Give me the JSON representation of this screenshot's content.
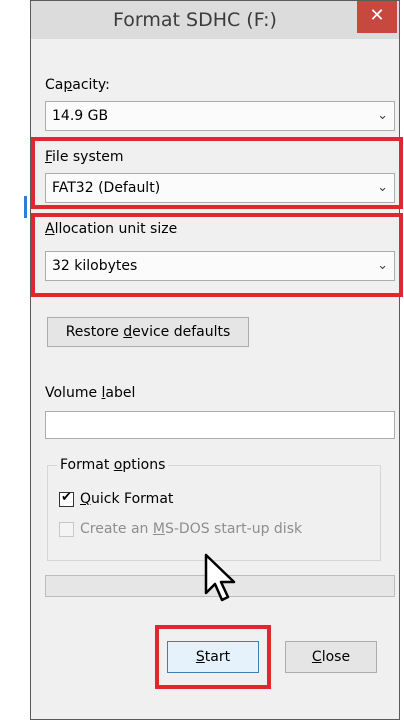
{
  "dialog": {
    "title": "Format SDHC (F:)",
    "close_glyph": "✕"
  },
  "capacity": {
    "label_pre": "Ca",
    "label_acc": "p",
    "label_post": "acity:",
    "value": "14.9 GB"
  },
  "file_system": {
    "label_acc": "F",
    "label_post": "ile system",
    "value": "FAT32 (Default)"
  },
  "allocation": {
    "label_acc": "A",
    "label_post": "llocation unit size",
    "value": "32 kilobytes"
  },
  "restore_button": {
    "pre": "Restore ",
    "acc": "d",
    "post": "evice defaults"
  },
  "volume_label": {
    "pre": "Volume ",
    "acc": "l",
    "post": "abel",
    "value": ""
  },
  "format_options": {
    "title_pre": "Format ",
    "title_acc": "o",
    "title_post": "ptions",
    "quick_format": {
      "acc": "Q",
      "post": "uick Format",
      "checked": true
    },
    "msdos": {
      "pre": "Create an ",
      "acc": "M",
      "post": "S-DOS start-up disk",
      "checked": false,
      "disabled": true
    }
  },
  "progress": {
    "value": 0
  },
  "buttons": {
    "start": {
      "acc": "S",
      "post": "tart"
    },
    "close": {
      "acc": "C",
      "post": "lose"
    }
  },
  "highlight_color": "#e0262f",
  "icons": {
    "dropdown": "chevron-down-icon",
    "cursor": "mouse-pointer-icon"
  }
}
